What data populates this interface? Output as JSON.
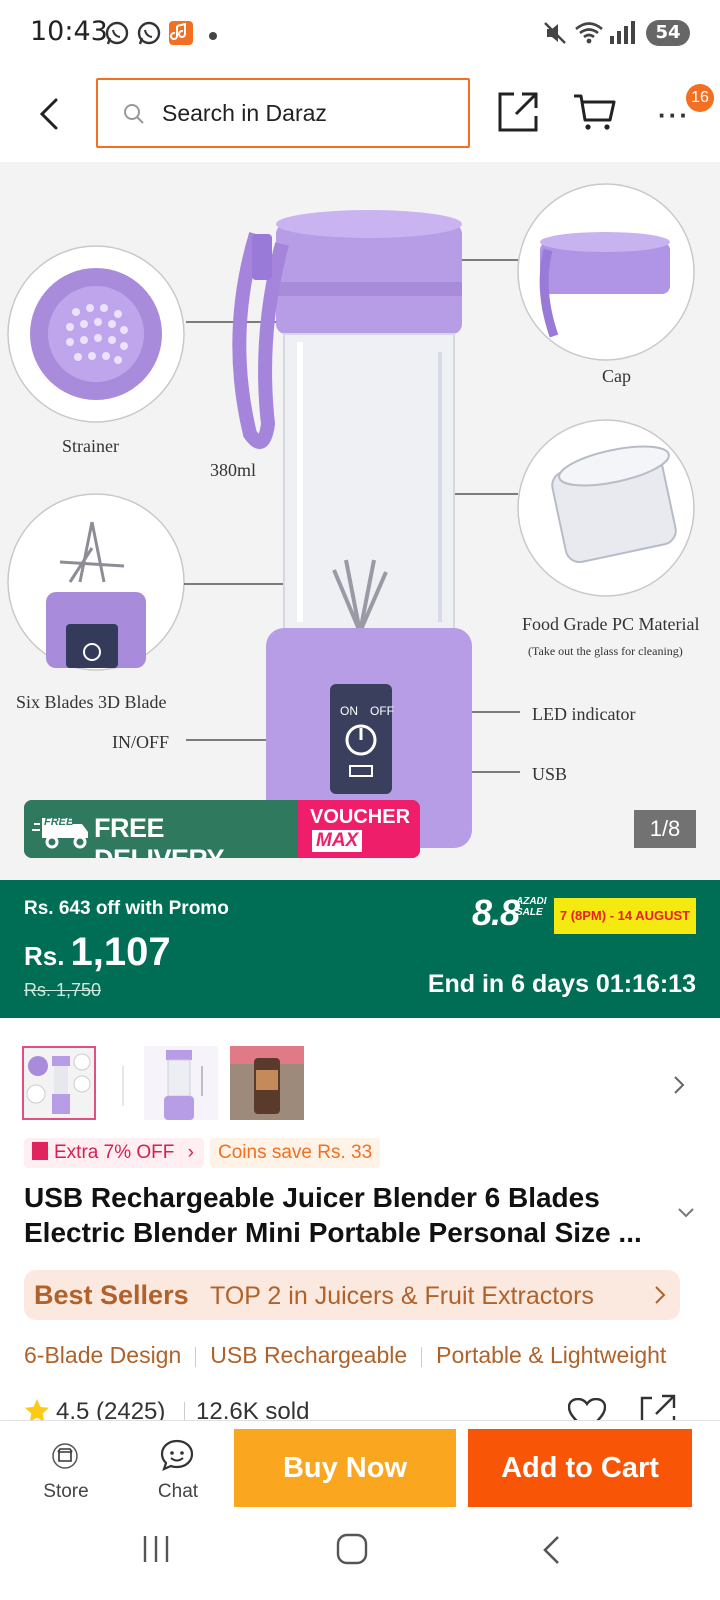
{
  "status_bar": {
    "time": "10:43",
    "battery": "54",
    "icons": [
      "whatsapp-icon",
      "whatsapp-business-icon",
      "app-notification-icon",
      "dot-icon",
      "mute-icon",
      "wifi-icon",
      "signal-icon"
    ]
  },
  "nav": {
    "search_placeholder": "Search in Daraz",
    "notification_count": "16"
  },
  "product_image": {
    "labels": {
      "strainer": "Strainer",
      "capacity": "380ml",
      "cap": "Cap",
      "food_grade": "Food Grade PC Material",
      "food_grade_note": "(Take out the glass for cleaning)",
      "blades": "Six Blades 3D Blade",
      "in_off": "IN/OFF",
      "led": "LED indicator",
      "usb": "USB",
      "on": "ON",
      "off": "OFF"
    },
    "free_delivery": "FREE DELIVERY",
    "free_tag": "FREE",
    "voucher": "VOUCHER",
    "voucher_max": "MAX",
    "counter": "1/8"
  },
  "promo": {
    "off_text": "Rs. 643 off with Promo",
    "currency": "Rs.",
    "price": "1,107",
    "old_price": "Rs. 1,750",
    "sale_logo": "8.8",
    "sale_sub": "AZADI SALE",
    "sale_dates": "7 (8PM) - 14 AUGUST",
    "countdown": "End in 6 days 01:16:13"
  },
  "tags": {
    "extra_off": "Extra 7% OFF",
    "coins": "Coins save Rs. 33"
  },
  "product": {
    "title": "USB Rechargeable Juicer Blender 6 Blades Electric Blender Mini Portable Personal Size ..."
  },
  "best_sellers": {
    "title": "Best Sellers",
    "rank": "TOP 2 in Juicers & Fruit Extractors"
  },
  "features": [
    "6-Blade Design",
    "USB Rechargeable",
    "Portable & Lightweight"
  ],
  "rating": {
    "score": "4.5",
    "count": "(2425)",
    "sold": "12.6K sold"
  },
  "bottom_bar": {
    "store": "Store",
    "chat": "Chat",
    "buy_now": "Buy Now",
    "add_to_cart": "Add to Cart"
  },
  "colors": {
    "brand_orange": "#f85606",
    "buy_now": "#fba61f",
    "promo_green": "#006e54",
    "product_purple": "#b79ce6"
  }
}
